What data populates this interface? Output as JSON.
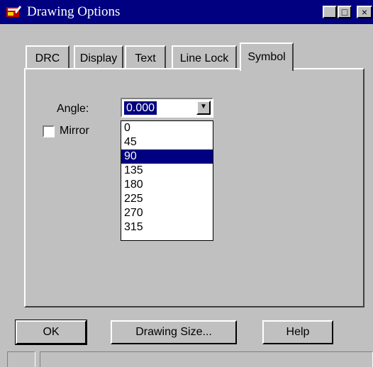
{
  "window": {
    "title": "Drawing Options",
    "controls": {
      "minimize": "_",
      "maximize": "□",
      "close": "×"
    }
  },
  "tabs": [
    {
      "label": "DRC"
    },
    {
      "label": "Display"
    },
    {
      "label": "Text"
    },
    {
      "label": "Line Lock"
    },
    {
      "label": "Symbol",
      "active": true
    }
  ],
  "symbol_tab": {
    "angle_label": "Angle:",
    "angle_value": "0.000",
    "mirror_label": "Mirror",
    "mirror_checked": false,
    "angle_options": [
      "0",
      "45",
      "90",
      "135",
      "180",
      "225",
      "270",
      "315"
    ],
    "highlighted_option": "90"
  },
  "buttons": {
    "ok": "OK",
    "drawing_size": "Drawing Size...",
    "help": "Help"
  },
  "icons": {
    "app": "drawing-app-icon",
    "dropdown": "chevron-down-icon"
  },
  "colors": {
    "titlebar": "#000080",
    "face": "#c0c0c0",
    "selection": "#000080"
  }
}
